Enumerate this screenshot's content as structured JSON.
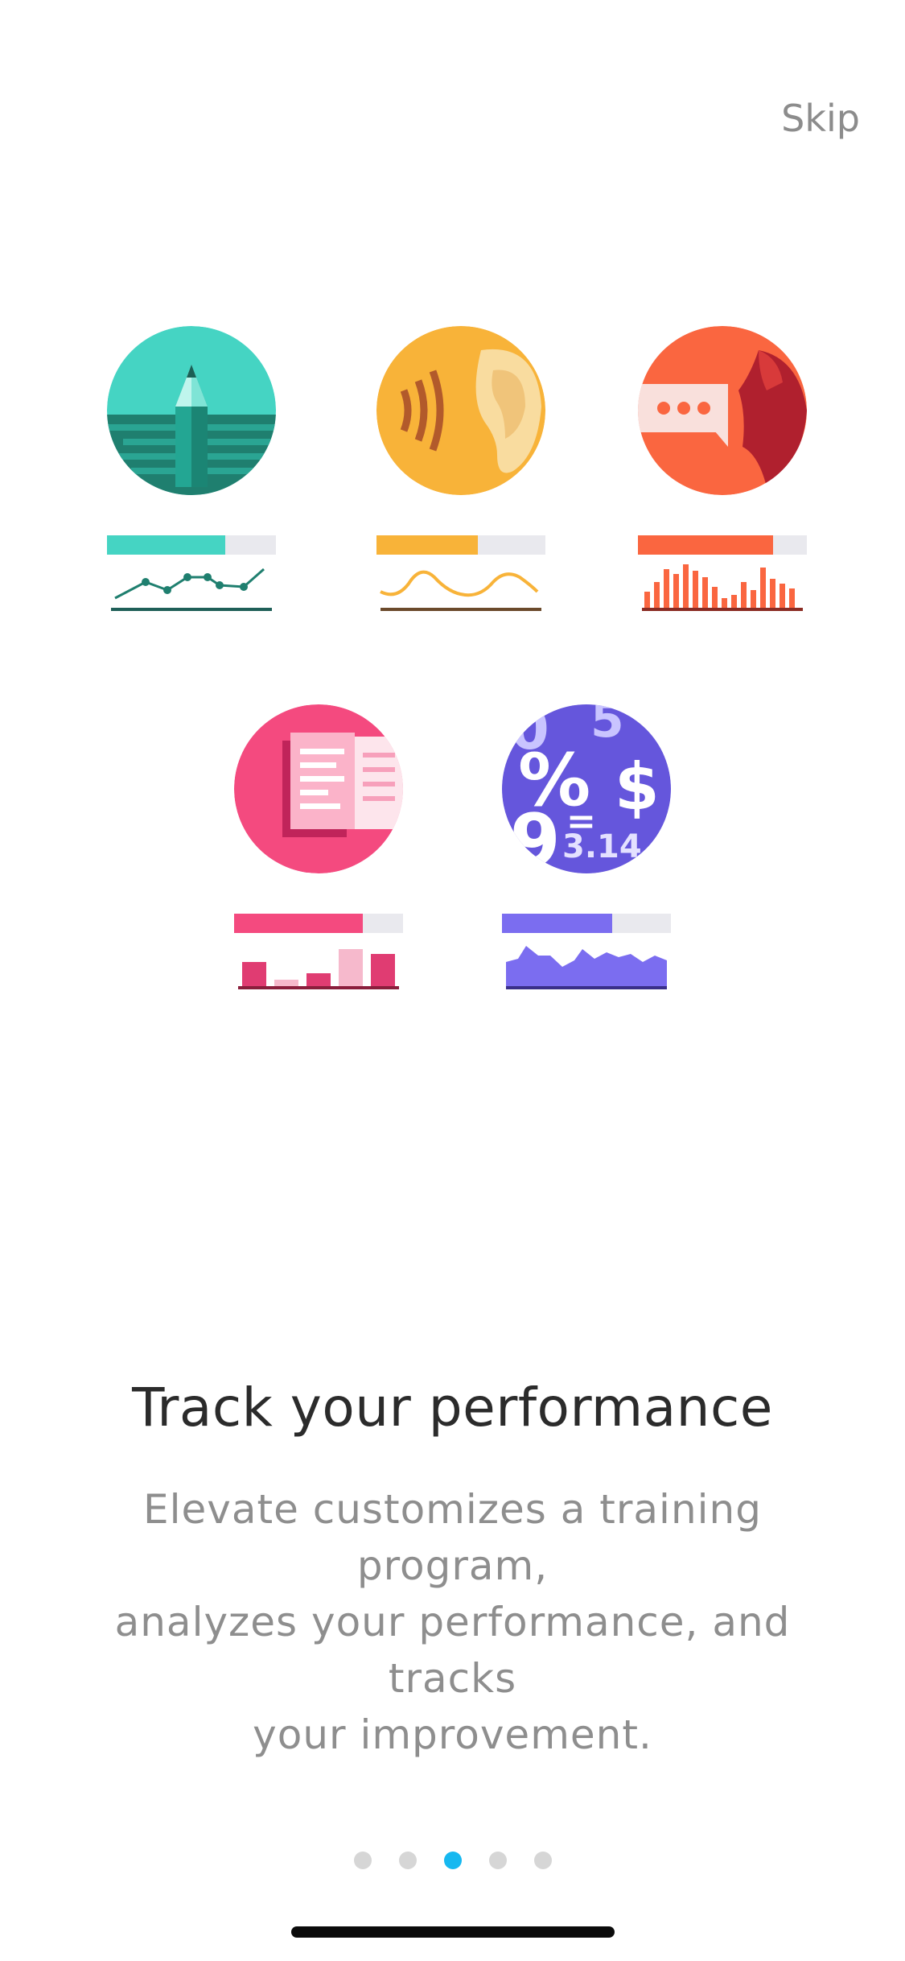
{
  "header": {
    "skip_label": "Skip"
  },
  "skills": [
    {
      "name": "writing",
      "icon": "pencil-icon",
      "color": "#45d4c3",
      "progress": 0.7,
      "chart": "line"
    },
    {
      "name": "listening",
      "icon": "ear-icon",
      "color": "#f8b339",
      "progress": 0.6,
      "chart": "wave"
    },
    {
      "name": "speaking",
      "icon": "speech-bubble-icon",
      "color": "#fa6640",
      "progress": 0.8,
      "chart": "bars"
    },
    {
      "name": "reading",
      "icon": "book-icon",
      "color": "#f44a7f",
      "progress": 0.76,
      "chart": "blocks"
    },
    {
      "name": "math",
      "icon": "numbers-icon",
      "color": "#7b6df0",
      "progress": 0.65,
      "chart": "area"
    }
  ],
  "content": {
    "headline": "Track your performance",
    "body_line1": "Elevate customizes a training program,",
    "body_line2": "analyzes your performance, and tracks",
    "body_line3": "your improvement."
  },
  "pagination": {
    "total": 5,
    "active_index": 2,
    "active_color": "#16b8f0"
  }
}
